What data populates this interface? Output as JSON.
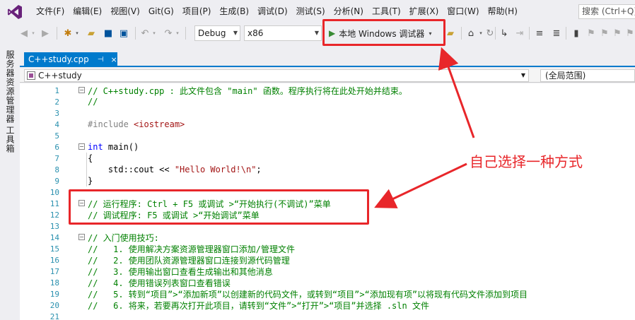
{
  "menu": {
    "items": [
      "文件(F)",
      "编辑(E)",
      "视图(V)",
      "Git(G)",
      "项目(P)",
      "生成(B)",
      "调试(D)",
      "测试(S)",
      "分析(N)",
      "工具(T)",
      "扩展(X)",
      "窗口(W)",
      "帮助(H)"
    ],
    "search_placeholder": "搜索 (Ctrl+Q)"
  },
  "toolbar": {
    "configuration": "Debug",
    "platform": "x86",
    "debugger_label": "本地 Windows 调试器"
  },
  "sidebar": {
    "tab1": "服务器资源管理器",
    "tab2": "工具箱"
  },
  "document": {
    "tab_name": "C++study.cpp",
    "tab_pin": "⊣",
    "tab_close": "×",
    "nav_scope": "C++study",
    "nav_member": "(全局范围)"
  },
  "code_lines": [
    {
      "n": "1",
      "fold": "−",
      "text": "// C++study.cpp : 此文件包含 \"main\" 函数。程序执行将在此处开始并结束。",
      "kind": "comment"
    },
    {
      "n": "2",
      "fold": "",
      "text": "//",
      "kind": "comment"
    },
    {
      "n": "3",
      "fold": "",
      "text": "",
      "kind": "plain"
    },
    {
      "n": "4",
      "fold": "",
      "text": "#include <iostream>",
      "kind": "include"
    },
    {
      "n": "5",
      "fold": "",
      "text": "",
      "kind": "plain"
    },
    {
      "n": "6",
      "fold": "−",
      "text": "int main()",
      "kind": "main"
    },
    {
      "n": "7",
      "fold": "",
      "text": "{",
      "kind": "plain"
    },
    {
      "n": "8",
      "fold": "",
      "text": "    std::cout << \"Hello World!\\n\";",
      "kind": "cout"
    },
    {
      "n": "9",
      "fold": "",
      "text": "}",
      "kind": "plain"
    },
    {
      "n": "10",
      "fold": "",
      "text": "",
      "kind": "plain"
    },
    {
      "n": "11",
      "fold": "−",
      "text": "// 运行程序: Ctrl + F5 或调试 >“开始执行(不调试)”菜单",
      "kind": "comment"
    },
    {
      "n": "12",
      "fold": "",
      "text": "// 调试程序: F5 或调试 >“开始调试”菜单",
      "kind": "comment"
    },
    {
      "n": "13",
      "fold": "",
      "text": "",
      "kind": "plain"
    },
    {
      "n": "14",
      "fold": "−",
      "text": "// 入门使用技巧:",
      "kind": "comment"
    },
    {
      "n": "15",
      "fold": "",
      "text": "//   1. 使用解决方案资源管理器窗口添加/管理文件",
      "kind": "comment"
    },
    {
      "n": "16",
      "fold": "",
      "text": "//   2. 使用团队资源管理器窗口连接到源代码管理",
      "kind": "comment"
    },
    {
      "n": "17",
      "fold": "",
      "text": "//   3. 使用输出窗口查看生成输出和其他消息",
      "kind": "comment"
    },
    {
      "n": "18",
      "fold": "",
      "text": "//   4. 使用错误列表窗口查看错误",
      "kind": "comment"
    },
    {
      "n": "19",
      "fold": "",
      "text": "//   5. 转到“项目”>“添加新项”以创建新的代码文件，或转到“项目”>“添加现有项”以将现有代码文件添加到项目",
      "kind": "comment"
    },
    {
      "n": "20",
      "fold": "",
      "text": "//   6. 将来，若要再次打开此项目，请转到“文件”>“打开”>“项目”并选择 .sln 文件",
      "kind": "comment"
    },
    {
      "n": "21",
      "fold": "",
      "text": "",
      "kind": "plain"
    }
  ],
  "annotation": {
    "text": "自己选择一种方式",
    "color": "#e8262a"
  },
  "colors": {
    "accent": "#007acc",
    "comment": "#008000",
    "keyword": "#0000ff",
    "string": "#a31515",
    "line_number": "#2b91af"
  }
}
